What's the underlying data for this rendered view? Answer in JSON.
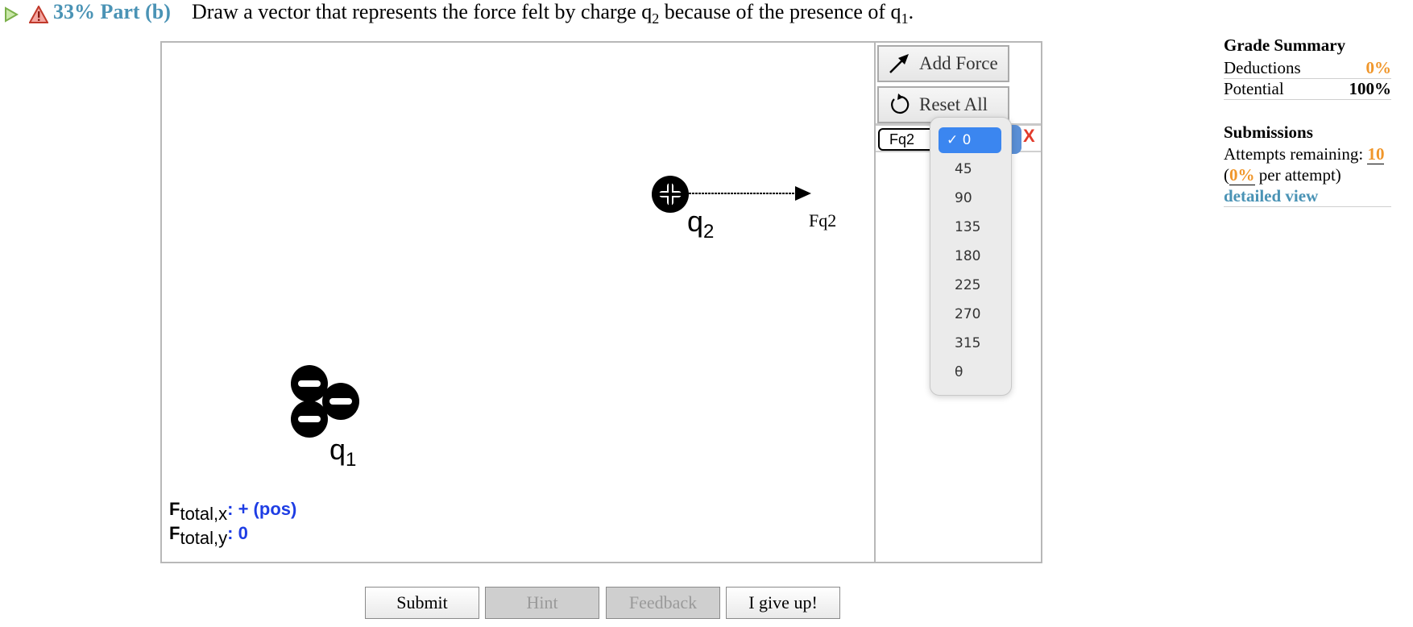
{
  "header": {
    "part_label": "33% Part (b)",
    "prompt_text": "Draw a vector that represents the force felt by charge q",
    "prompt_sub1": "2",
    "prompt_mid": " because of the presence of q",
    "prompt_sub2": "1",
    "prompt_end": "."
  },
  "canvas": {
    "q2_label": "q",
    "q2_sub": "2",
    "q1_label": "q",
    "q1_sub": "1",
    "vector_label": "Fq2",
    "total_x_label": "F",
    "total_x_sub": "total,x",
    "total_x_value": ": + (pos)",
    "total_y_label": "F",
    "total_y_sub": "total,y",
    "total_y_value": ": 0"
  },
  "panel": {
    "add_force_label": "Add Force",
    "reset_all_label": "Reset All",
    "force_name": "Fq2",
    "delete_label": "X",
    "angle_options": [
      "0",
      "45",
      "90",
      "135",
      "180",
      "225",
      "270",
      "315",
      "θ"
    ],
    "selected_angle": "0",
    "selected_check": "✓ 0"
  },
  "grade_summary": {
    "title": "Grade Summary",
    "deductions_label": "Deductions",
    "deductions_value": "0%",
    "potential_label": "Potential",
    "potential_value": "100%",
    "submissions_title": "Submissions",
    "attempts_label": "Attempts remaining:",
    "attempts_value": "10",
    "per_attempt_open": "(",
    "per_attempt_value": "0%",
    "per_attempt_text": " per attempt)",
    "detailed_view": "detailed view"
  },
  "buttons": {
    "submit": "Submit",
    "hint": "Hint",
    "feedback": "Feedback",
    "give_up": "I give up!"
  },
  "colors": {
    "accent": "#4a93b5",
    "orange": "#f0962a",
    "value_blue": "#1e3de4",
    "delete_red": "#e23b2c",
    "select_blue": "#3b86f0"
  }
}
